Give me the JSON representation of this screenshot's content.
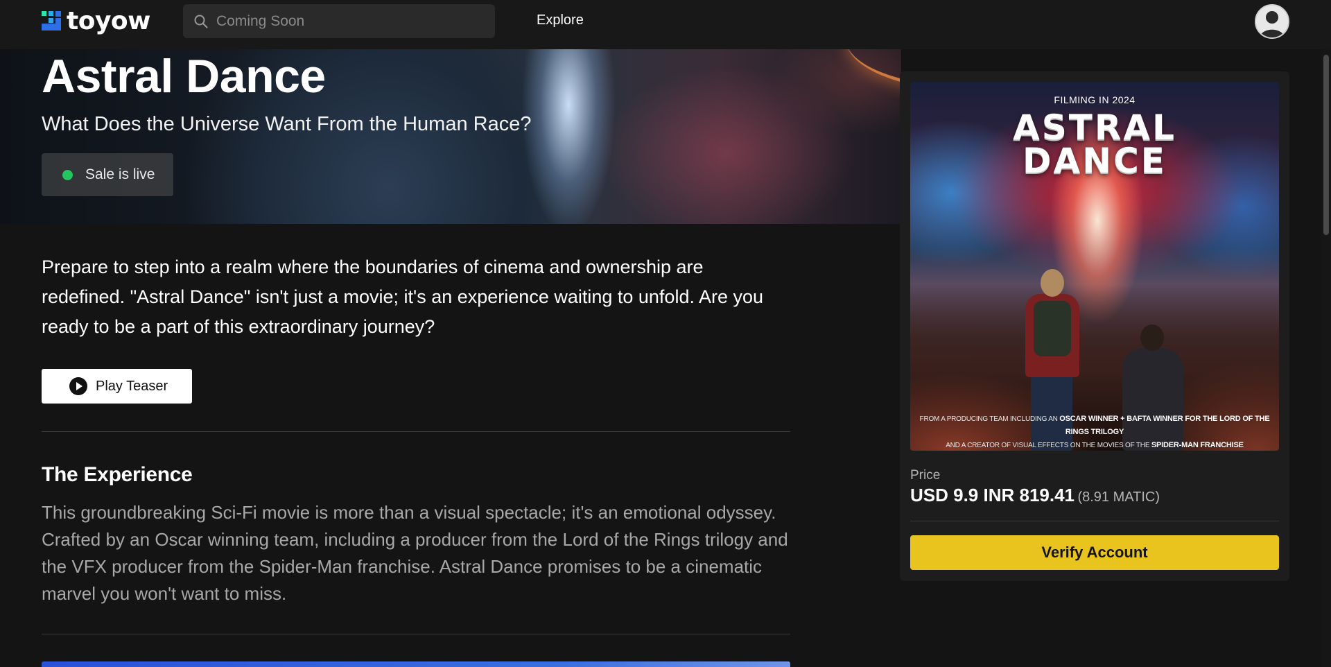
{
  "nav": {
    "brand": "toyow",
    "search_placeholder": "Coming Soon",
    "explore_label": "Explore"
  },
  "hero": {
    "title": "Astral Dance",
    "subtitle": "What Does the Universe Want From the Human Race?",
    "sale_status": "Sale is live",
    "sale_status_color": "#22c55e"
  },
  "intro": {
    "text": "Prepare to step into a realm where the boundaries of cinema and ownership are redefined. \"Astral Dance\" isn't just a movie; it's an experience waiting to unfold. Are you ready to be a part of this extraordinary journey?",
    "play_label": "Play Teaser"
  },
  "experience": {
    "title": "The Experience",
    "body": "This groundbreaking Sci-Fi movie is more than a visual spectacle; it's an emotional odyssey. Crafted by an Oscar winning team, including a producer from the Lord of the Rings trilogy and the VFX producer from the Spider-Man franchise. Astral Dance promises to be a cinematic marvel you won't want to miss."
  },
  "poster": {
    "filming": "FILMING IN 2024",
    "title_line1": "ASTRAL",
    "title_line2": "DANCE",
    "credits_line1_a": "FROM A PRODUCING TEAM INCLUDING AN",
    "credits_line1_b": "OSCAR WINNER + BAFTA WINNER FOR THE LORD OF THE RINGS TRILOGY",
    "credits_line2_a": "AND A CREATOR OF VISUAL EFFECTS ON THE MOVIES OF THE",
    "credits_line2_b": "SPIDER-MAN FRANCHISE"
  },
  "purchase": {
    "price_label": "Price",
    "price_main": "USD 9.9 INR 819.41",
    "price_matic": "(8.91 MATIC)",
    "verify_label": "Verify Account",
    "accent_color": "#e9c41f"
  }
}
